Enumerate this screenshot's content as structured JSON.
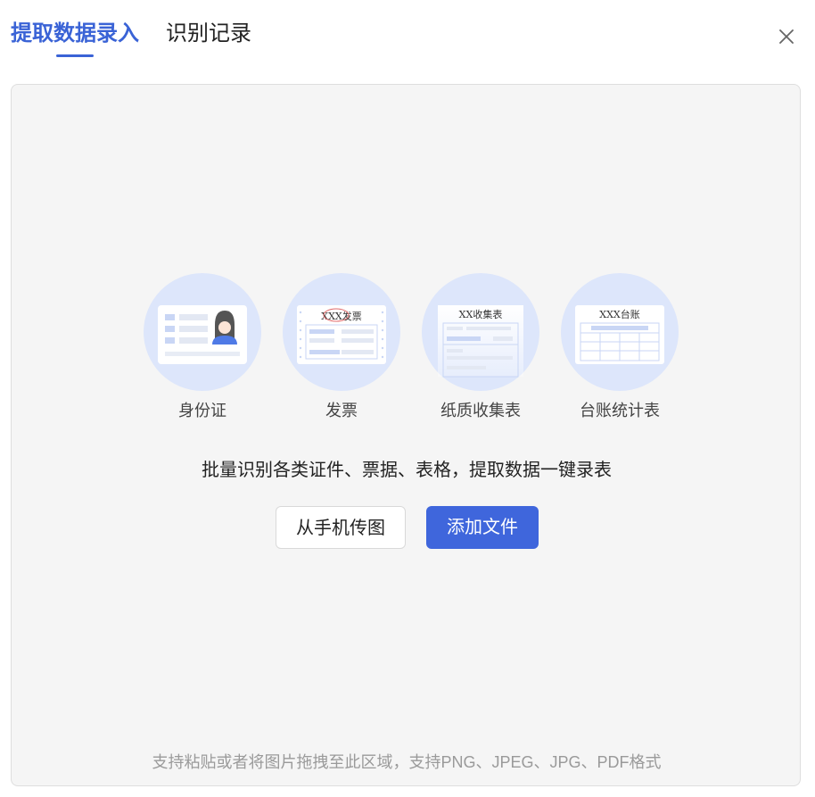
{
  "header": {
    "tabs": [
      {
        "label": "提取数据录入",
        "active": true
      },
      {
        "label": "识别记录",
        "active": false
      }
    ],
    "close_icon": "close-icon"
  },
  "upload": {
    "types": [
      {
        "label": "身份证",
        "icon": "id-card-icon",
        "text": ""
      },
      {
        "label": "发票",
        "icon": "invoice-icon",
        "text": "XXX发票"
      },
      {
        "label": "纸质收集表",
        "icon": "paper-form-icon",
        "text": "XX收集表"
      },
      {
        "label": "台账统计表",
        "icon": "ledger-table-icon",
        "text": "XXX台账"
      }
    ],
    "description": "批量识别各类证件、票据、表格，提取数据一键录表",
    "buttons": {
      "phone_upload": "从手机传图",
      "add_file": "添加文件"
    },
    "hint": "支持粘贴或者将图片拖拽至此区域，支持PNG、JPEG、JPG、PDF格式"
  },
  "colors": {
    "accent": "#3a63d6",
    "primary_button": "#3f66dc",
    "circle_bg": "#dde6fb",
    "drop_bg": "#f5f5f5"
  }
}
